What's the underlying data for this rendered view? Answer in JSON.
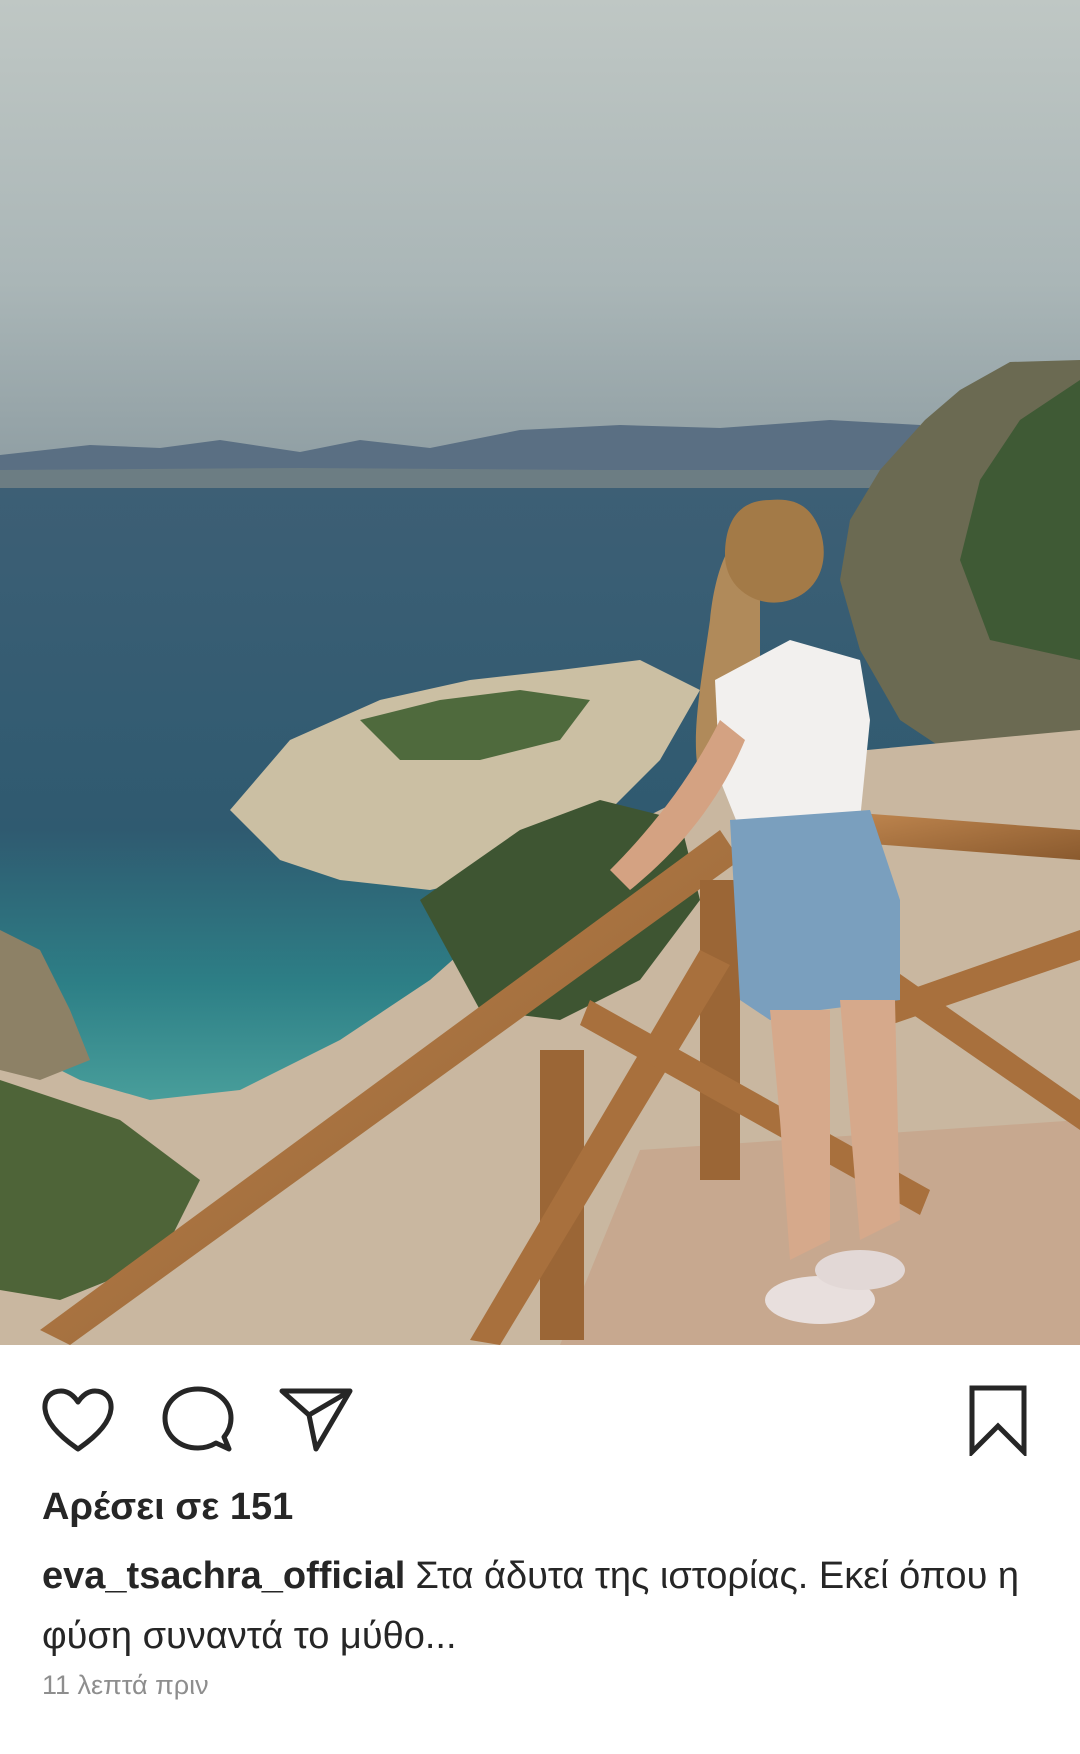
{
  "post": {
    "photo_icon": "photo",
    "likes_text": "Αρέσει σε 151",
    "username": "eva_tsachra_official",
    "caption": "Στα άδυτα της ιστορίας. Εκεί όπου η φύση συναντά το μύθο...",
    "time_ago": "11 λεπτά πριν"
  },
  "actions": {
    "like_icon": "heart-outline",
    "comment_icon": "speech-bubble",
    "share_icon": "paper-plane",
    "save_icon": "bookmark-outline"
  },
  "colors": {
    "text": "#262626",
    "secondary_text": "#8e8e8e",
    "background": "#ffffff"
  }
}
